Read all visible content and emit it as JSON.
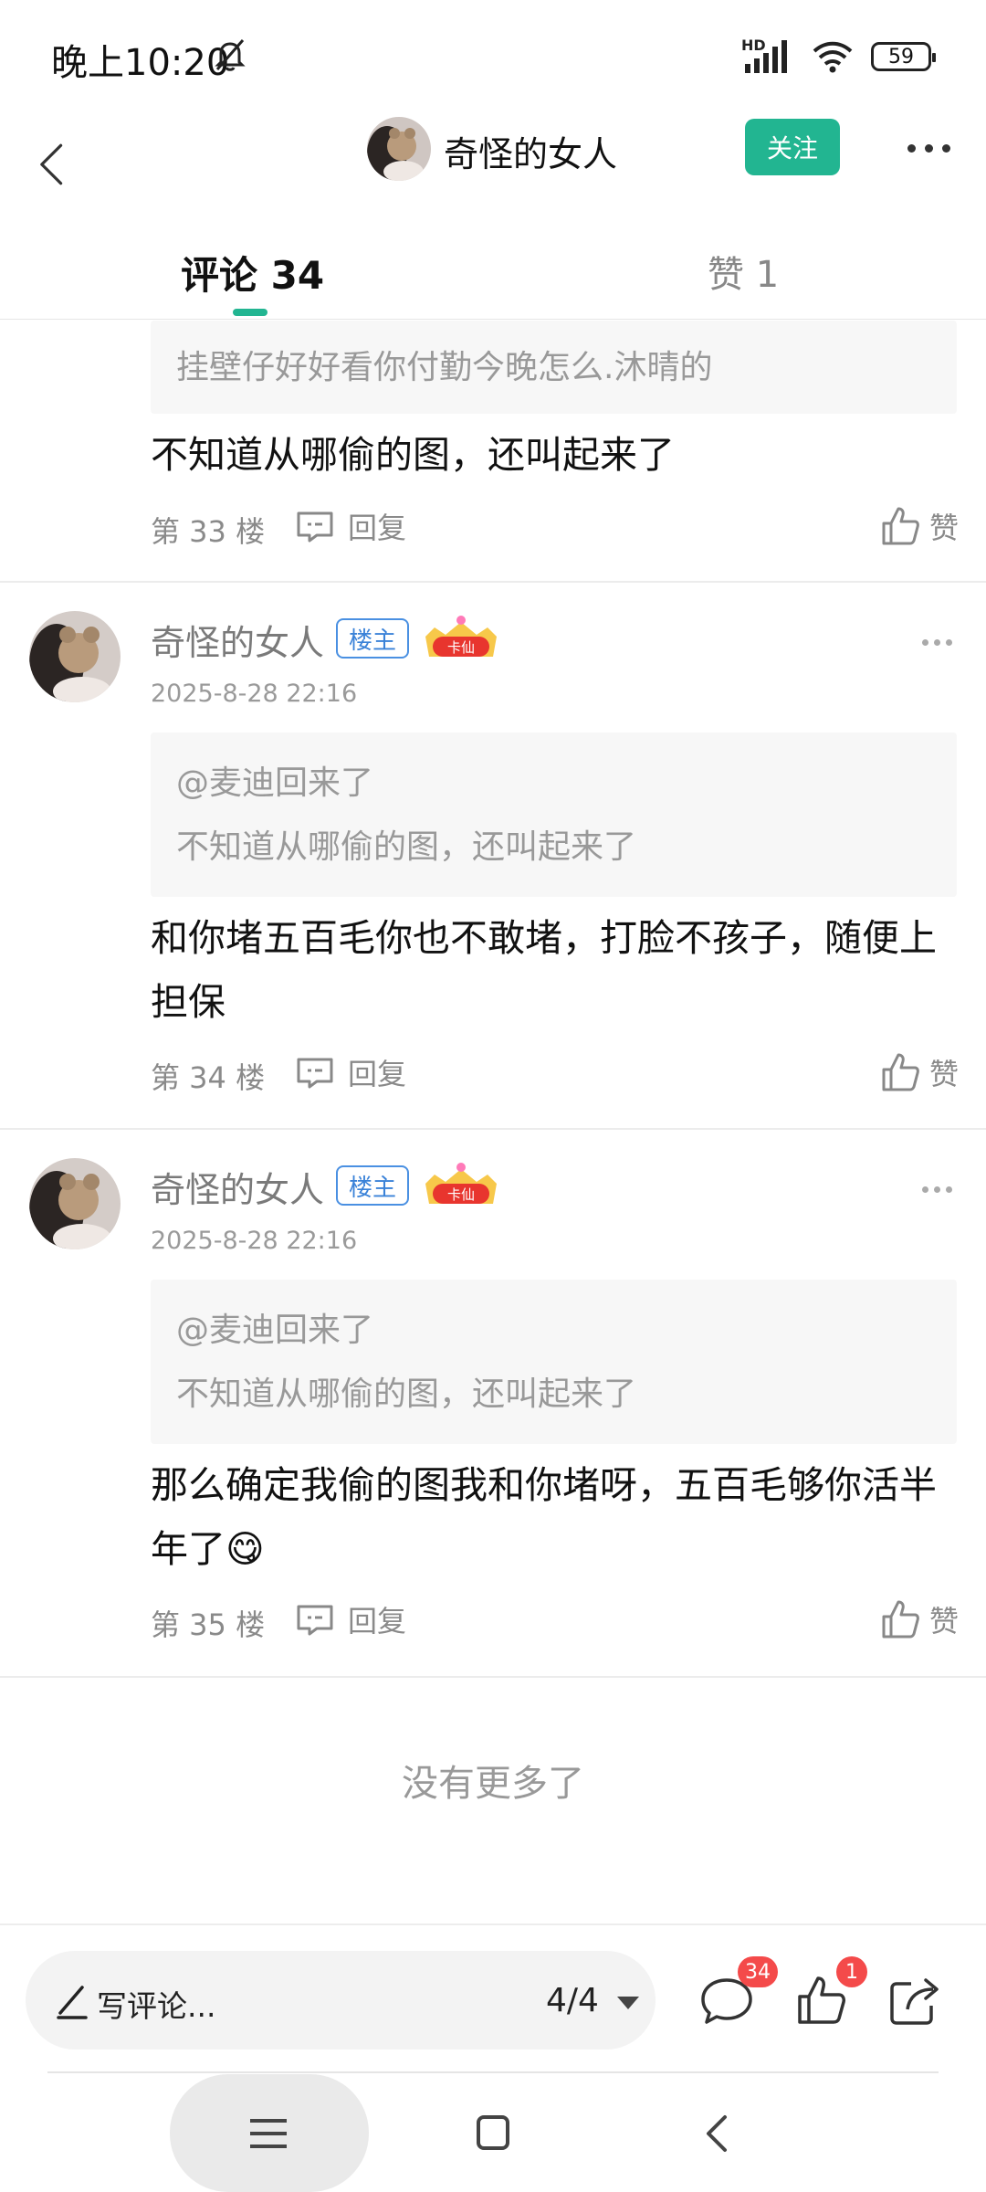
{
  "status_bar": {
    "time": "晚上10:20",
    "network": "HD",
    "battery": "59",
    "icons": [
      "mute-bell-icon",
      "signal-icon",
      "wifi-icon",
      "battery-icon"
    ]
  },
  "header": {
    "user_name": "奇怪的女人",
    "follow_label": "关注",
    "icons": [
      "back-arrow-icon",
      "more-dots-icon"
    ]
  },
  "tabs": {
    "comments_label": "评论 34",
    "likes_label": "赞 1"
  },
  "first_comment": {
    "quote_text": "挂壁仔好好看你付勤今晚怎么.沐晴的",
    "text": "不知道从哪偷的图，还叫起来了",
    "floor": "第 33 楼",
    "reply_label": "回复",
    "like_label": "赞"
  },
  "comments": [
    {
      "author": "奇怪的女人",
      "owner_badge": "楼主",
      "level_badge": "卡仙",
      "date": "2025-8-28 22:16",
      "quote_mention": "@麦迪回来了",
      "quote_text": "不知道从哪偷的图，还叫起来了",
      "text": "和你堵五百毛你也不敢堵，打脸不孩子，随便上担保",
      "floor": "第 34 楼",
      "reply_label": "回复",
      "like_label": "赞"
    },
    {
      "author": "奇怪的女人",
      "owner_badge": "楼主",
      "level_badge": "卡仙",
      "date": "2025-8-28 22:16",
      "quote_mention": "@麦迪回来了",
      "quote_text": "不知道从哪偷的图，还叫起来了",
      "text": "那么确定我偷的图我和你堵呀，五百毛够你活半年了",
      "emoji": "😋",
      "floor": "第 35 楼",
      "reply_label": "回复",
      "like_label": "赞"
    }
  ],
  "footer": {
    "no_more": "没有更多了"
  },
  "bottom_bar": {
    "write_placeholder": "写评论...",
    "page_indicator": "4/4",
    "comment_count": "34",
    "like_count": "1",
    "icons": [
      "pencil-icon",
      "comment-icon",
      "thumbs-up-icon",
      "share-icon"
    ]
  },
  "colors": {
    "accent": "#22b591",
    "badge_red": "#f44a4a",
    "owner_badge_blue": "#3a82d8"
  }
}
